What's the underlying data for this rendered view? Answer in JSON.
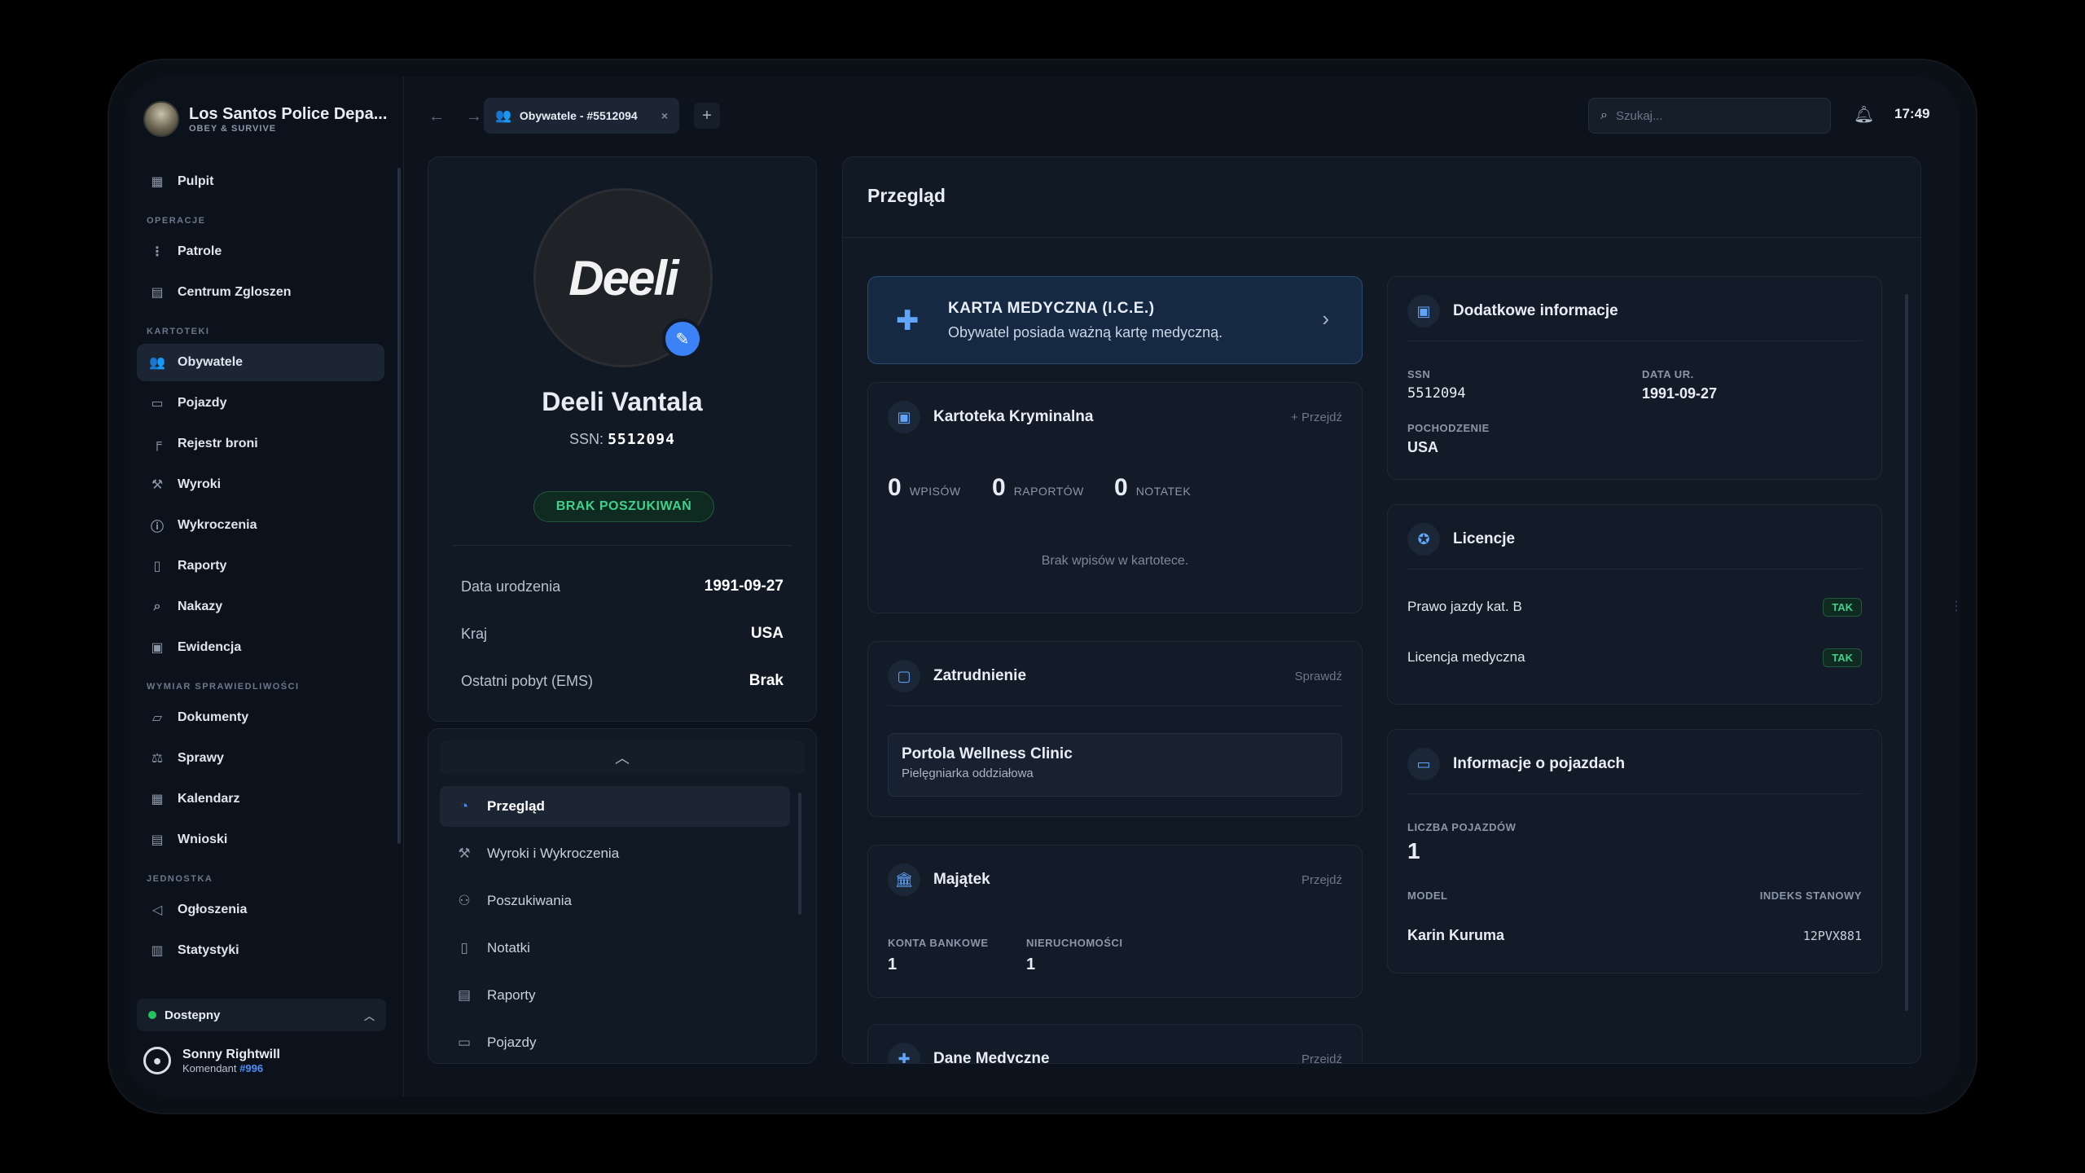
{
  "brand": {
    "title": "Los Santos Police Depa...",
    "subtitle": "OBEY & SURVIVE"
  },
  "sidebar": {
    "top": [
      {
        "label": "Pulpit",
        "icon": "grid-icon"
      }
    ],
    "sections": [
      {
        "title": "OPERACJE",
        "items": [
          {
            "label": "Patrole",
            "icon": "route-icon"
          },
          {
            "label": "Centrum Zgloszen",
            "icon": "inbox-icon"
          }
        ]
      },
      {
        "title": "KARTOTEKI",
        "items": [
          {
            "label": "Obywatele",
            "icon": "users-icon",
            "active": true
          },
          {
            "label": "Pojazdy",
            "icon": "car-icon"
          },
          {
            "label": "Rejestr broni",
            "icon": "gun-icon"
          },
          {
            "label": "Wyroki",
            "icon": "gavel-icon"
          },
          {
            "label": "Wykroczenia",
            "icon": "alert-circle-icon"
          },
          {
            "label": "Raporty",
            "icon": "file-icon"
          },
          {
            "label": "Nakazy",
            "icon": "file-search-icon"
          },
          {
            "label": "Ewidencja",
            "icon": "archive-icon"
          }
        ]
      },
      {
        "title": "WYMIAR SPRAWIEDLIWOŚCI",
        "items": [
          {
            "label": "Dokumenty",
            "icon": "folder-icon"
          },
          {
            "label": "Sprawy",
            "icon": "scale-icon"
          },
          {
            "label": "Kalendarz",
            "icon": "calendar-icon"
          },
          {
            "label": "Wnioski",
            "icon": "clipboard-icon"
          }
        ]
      },
      {
        "title": "JEDNOSTKA",
        "items": [
          {
            "label": "Ogłoszenia",
            "icon": "megaphone-icon"
          },
          {
            "label": "Statystyki",
            "icon": "bar-chart-icon"
          }
        ]
      }
    ],
    "status": "Dostepny",
    "user": {
      "name": "Sonny Rightwill",
      "role": "Komendant",
      "badge": "#996"
    }
  },
  "topbar": {
    "tab_label": "Obywatele - #5512094",
    "search_placeholder": "Szukaj...",
    "time": "17:49"
  },
  "profile": {
    "avatar_text": "Deeli",
    "name": "Deeli Vantala",
    "ssn_label": "SSN:",
    "ssn": "5512094",
    "status_badge": "BRAK POSZUKIWAŃ",
    "rows": [
      {
        "label": "Data urodzenia",
        "value": "1991-09-27"
      },
      {
        "label": "Kraj",
        "value": "USA"
      },
      {
        "label": "Ostatni pobyt (EMS)",
        "value": "Brak"
      }
    ]
  },
  "profile_menu": [
    {
      "label": "Przegląd",
      "icon": "pie-chart-icon",
      "active": true
    },
    {
      "label": "Wyroki i Wykroczenia",
      "icon": "gavel-icon"
    },
    {
      "label": "Poszukiwania",
      "icon": "user-search-icon"
    },
    {
      "label": "Notatki",
      "icon": "note-icon"
    },
    {
      "label": "Raporty",
      "icon": "file-icon"
    },
    {
      "label": "Pojazdy",
      "icon": "car-icon"
    }
  ],
  "main": {
    "title": "Przegląd",
    "ice": {
      "title": "KARTA MEDYCZNA (I.C.E.)",
      "subtitle": "Obywatel posiada ważną kartę medyczną."
    },
    "criminal": {
      "title": "Kartoteka Kryminalna",
      "link": "+ Przejdź",
      "counts": [
        {
          "value": "0",
          "label": "WPISÓW"
        },
        {
          "value": "0",
          "label": "RAPORTÓW"
        },
        {
          "value": "0",
          "label": "NOTATEK"
        }
      ],
      "empty": "Brak wpisów w kartotece."
    },
    "employment": {
      "title": "Zatrudnienie",
      "link": "Sprawdź",
      "company": "Portola Wellness Clinic",
      "position": "Pielęgniarka oddziałowa"
    },
    "assets": {
      "title": "Majątek",
      "link": "Przejdź",
      "bank_label": "KONTA BANKOWE",
      "bank_value": "1",
      "estate_label": "NIERUCHOMOŚCI",
      "estate_value": "1"
    },
    "medical": {
      "title": "Dane Medyczne",
      "link": "Przejdź"
    },
    "extra": {
      "title": "Dodatkowe informacje",
      "ssn_label": "SSN",
      "ssn_value": "5512094",
      "dob_label": "DATA UR.",
      "dob_value": "1991-09-27",
      "origin_label": "POCHODZENIE",
      "origin_value": "USA"
    },
    "licenses": {
      "title": "Licencje",
      "items": [
        {
          "label": "Prawo jazdy kat. B",
          "value": "TAK"
        },
        {
          "label": "Licencja medyczna",
          "value": "TAK"
        }
      ]
    },
    "vehicles": {
      "title": "Informacje o pojazdach",
      "count_label": "LICZBA POJAZDÓW",
      "count": "1",
      "model_header": "MODEL",
      "index_header": "INDEKS STANOWY",
      "model": "Karin Kuruma",
      "plate": "12PVX881"
    }
  }
}
